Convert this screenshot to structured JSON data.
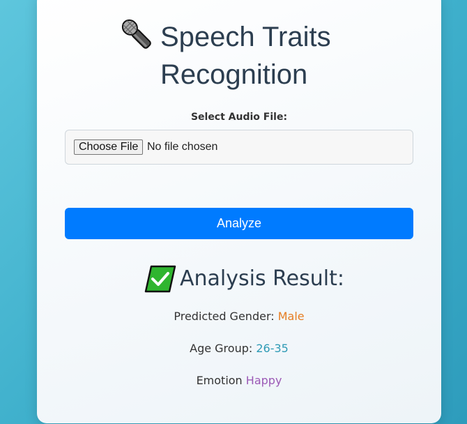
{
  "header": {
    "title_line1": "Speech Traits",
    "title_line2": "Recognition",
    "icon": "microphone-icon"
  },
  "form": {
    "file_label": "Select Audio File:",
    "choose_button_label": "Choose File",
    "file_status": "No file chosen",
    "analyze_button_label": "Analyze"
  },
  "result": {
    "icon": "check-mark-icon",
    "title": "Analysis Result:",
    "gender_label": "Predicted Gender:",
    "gender_value": "Male",
    "age_label": "Age Group:",
    "age_value": "26-35",
    "emotion_label": "Emotion",
    "emotion_value": "Happy"
  },
  "colors": {
    "background_gradient": [
      "#5ec6dd",
      "#2e9cbc"
    ],
    "title": "#2c3e50",
    "button": "#007bff",
    "gender_value": "#e67e22",
    "age_value": "#2e9ab5",
    "emotion_value": "#9b59b6"
  }
}
